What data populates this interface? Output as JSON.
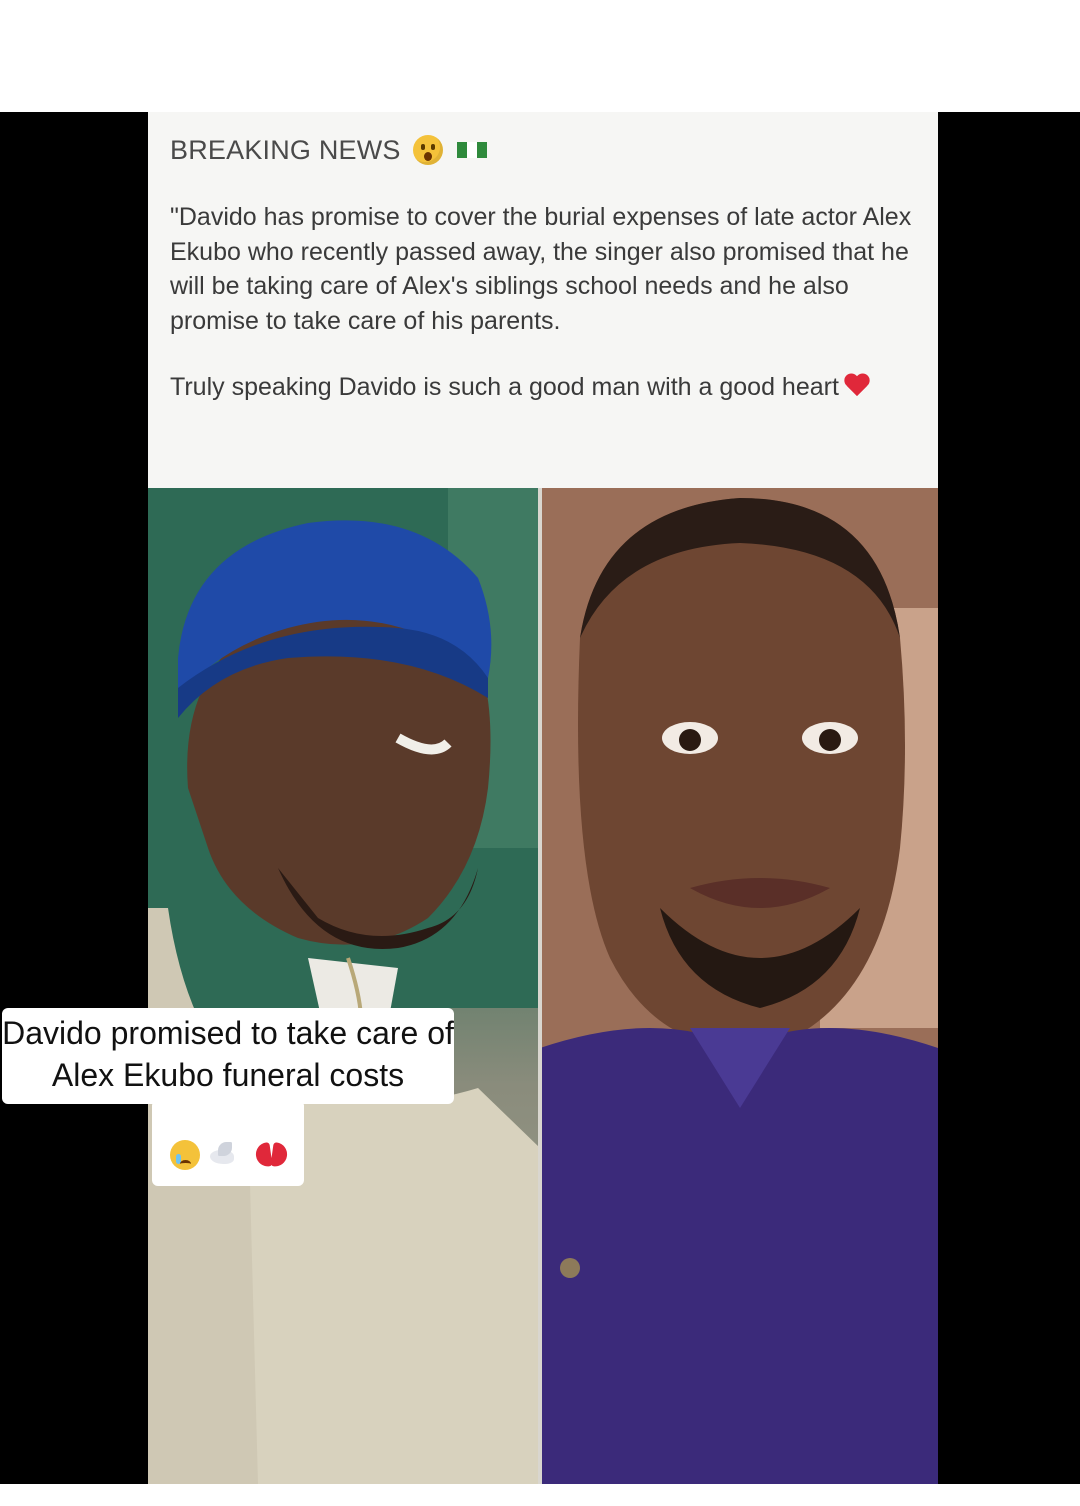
{
  "post": {
    "headline": "BREAKING NEWS",
    "headline_emoji": "astonished-face-icon",
    "headline_flag": "nigeria-flag-icon",
    "paragraph_1": "\"Davido has promise to cover the burial expenses of late actor Alex Ekubo who recently passed away, the singer also promised that he will be taking care of Alex's siblings school needs and he also promise to take care of his parents.",
    "paragraph_2": "Truly speaking Davido is such a good man with a good heart",
    "heart_icon": "red-heart-icon",
    "colors": {
      "header_background": "#f6f6f4",
      "text": "#3a3a3a",
      "heart": "#e0283a"
    }
  },
  "photos": {
    "left": "photo-davido",
    "right": "photo-alex-ekubo"
  },
  "caption": {
    "text": "Davido promised to take care of Alex Ekubo funeral costs",
    "emojis": [
      "crying-face-icon",
      "dove-icon",
      "broken-heart-icon"
    ]
  }
}
